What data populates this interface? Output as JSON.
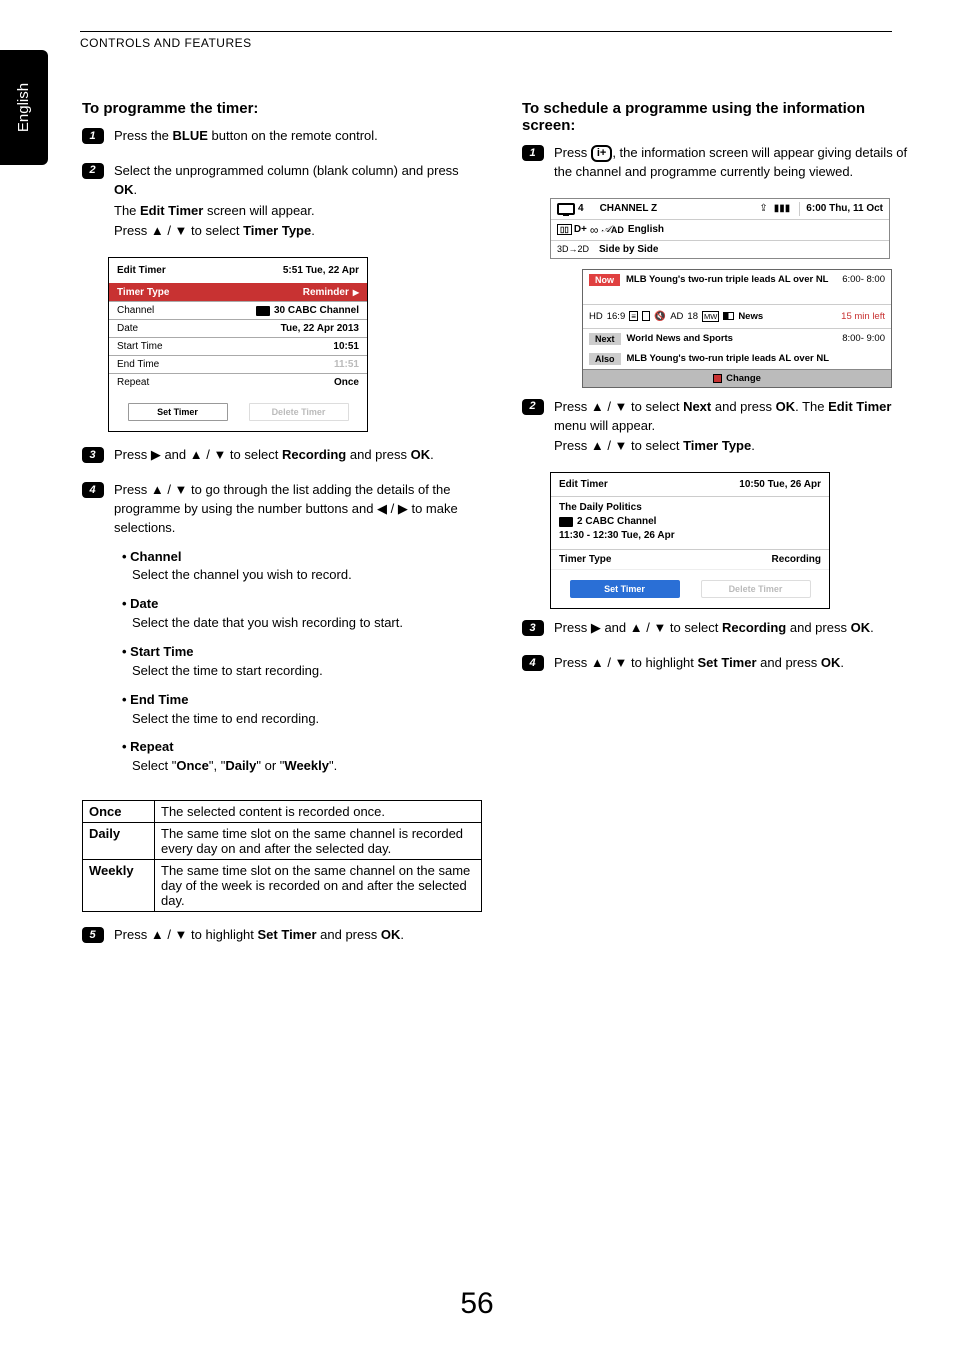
{
  "header": "CONTROLS AND FEATURES",
  "lang_tab": "English",
  "left": {
    "title": "To programme the timer:",
    "step1": {
      "prefix": "Press the ",
      "blue": "BLUE",
      "suffix": " button on the remote control."
    },
    "step2": {
      "l1a": "Select the unprogrammed column (blank column) and press ",
      "l1b": "OK",
      "l1c": ".",
      "l2a": "The ",
      "l2b": "Edit Timer",
      "l2c": " screen will appear.",
      "l3a": "Press ▲ / ▼ to select ",
      "l3b": "Timer Type",
      "l3c": "."
    },
    "panel1": {
      "title": "Edit Timer",
      "time": "5:51 Tue, 22 Apr",
      "rows": {
        "r1k": "Timer Type",
        "r1v": "Reminder",
        "r2k": "Channel",
        "r2v": "30 CABC Channel",
        "r3k": "Date",
        "r3v": "Tue, 22 Apr 2013",
        "r4k": "Start Time",
        "r4v": "10:51",
        "r5k": "End Time",
        "r5v": "11:51",
        "r6k": "Repeat",
        "r6v": "Once"
      },
      "btn1": "Set Timer",
      "btn2": "Delete Timer"
    },
    "step3": {
      "a": "Press ▶ and ▲  / ▼ to select ",
      "b": "Recording",
      "c": " and press ",
      "d": "OK",
      "e": "."
    },
    "step4": {
      "intro": "Press ▲ / ▼ to go through the list adding the details of the programme by using the number buttons and ◀ / ▶ to make selections.",
      "items": {
        "i1t": "Channel",
        "i1d": "Select the channel you wish to record.",
        "i2t": "Date",
        "i2d": "Select the date that you wish recording to start.",
        "i3t": "Start Time",
        "i3d": "Select the time to start recording.",
        "i4t": "End Time",
        "i4d": "Select the time to end recording.",
        "i5t": "Repeat",
        "i5d": "Select \"Once\", \"Daily\" or \"Weekly\"."
      }
    },
    "repeat_table": {
      "r1k": "Once",
      "r1v": "The selected content is recorded once.",
      "r2k": "Daily",
      "r2v": "The same time slot on the same channel is recorded every day on and after the selected day.",
      "r3k": "Weekly",
      "r3v": "The same time slot on the same channel on the same day of the week is recorded on and after the selected day."
    },
    "step5": {
      "a": "Press ▲ / ▼ to highlight ",
      "b": "Set Timer",
      "c": " and press ",
      "d": "OK",
      "e": "."
    }
  },
  "right": {
    "title": "To schedule a programme using the information screen:",
    "step1": {
      "a": "Press ",
      "b": ", the information screen will appear giving details of the channel and programme currently being viewed."
    },
    "infobox_btn": "i+",
    "infobar": {
      "ch_num": "4",
      "ch_name": "CHANNEL Z",
      "datetime": "6:00 Thu, 11 Oct",
      "row2_dolby": "D+",
      "row2_ad": "AD",
      "row2_lang": "English",
      "row3_a": "3D→2D",
      "row3_b": "Side by Side"
    },
    "infopanel": {
      "now_tag": "Now",
      "now_text": "MLB Young's two-run triple leads AL over NL",
      "now_time": "6:00- 8:00",
      "icons_line": {
        "hd": "HD",
        "ratio": "16:9",
        "ad": "AD",
        "age": "18",
        "mw": "MW",
        "cat": "News",
        "left": "15 min left"
      },
      "next_tag": "Next",
      "next_text": "World News and Sports",
      "next_time": "8:00- 9:00",
      "also_tag": "Also",
      "also_text": "MLB Young's two-run triple leads AL over NL",
      "change": "Change"
    },
    "step2": {
      "a": "Press ▲ / ▼ to select ",
      "b": "Next",
      "c": " and press ",
      "d": "OK",
      "e": ". The ",
      "f": "Edit Timer",
      "g": " menu will appear.",
      "h": "Press ▲ / ▼ to select ",
      "i": "Timer Type",
      "j": "."
    },
    "panel2": {
      "title": "Edit Timer",
      "time": "10:50 Tue, 26 Apr",
      "prog": "The Daily Politics",
      "ch": "2  CABC  Channel",
      "range": "11:30 - 12:30 Tue, 26 Apr",
      "tt_label": "Timer Type",
      "tt_val": "Recording",
      "btn1": "Set Timer",
      "btn2": "Delete Timer"
    },
    "step3": {
      "a": "Press ▶ and ▲  / ▼ to select ",
      "b": "Recording",
      "c": " and press ",
      "d": "OK",
      "e": "."
    },
    "step4": {
      "a": "Press ▲ / ▼ to highlight ",
      "b": "Set Timer",
      "c": " and press ",
      "d": "OK",
      "e": "."
    }
  },
  "page_num": "56"
}
